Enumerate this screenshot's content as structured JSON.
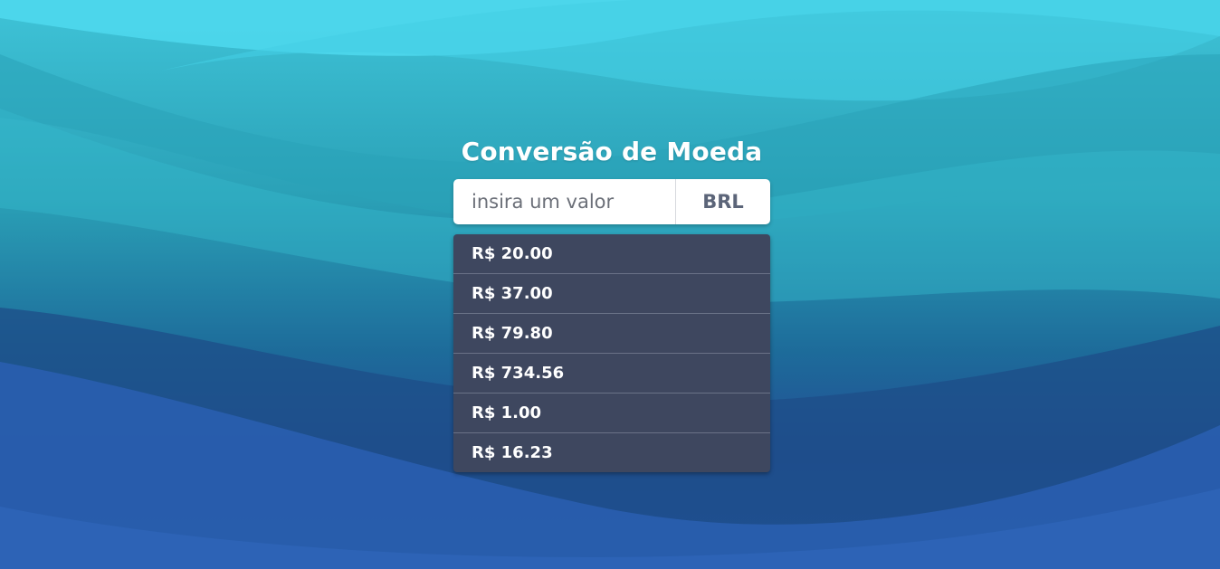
{
  "page": {
    "title": "Conversão de Moeda"
  },
  "converter": {
    "input_value": "",
    "input_placeholder": "insira um valor",
    "currency": "BRL"
  },
  "results": [
    {
      "label": "R$ 20.00"
    },
    {
      "label": "R$ 37.00"
    },
    {
      "label": "R$ 79.80"
    },
    {
      "label": "R$ 734.56"
    },
    {
      "label": "R$ 1.00"
    },
    {
      "label": "R$ 16.23"
    }
  ],
  "theme": {
    "background_top": "#3fc4d8",
    "background_bottom": "#2457a6",
    "panel_color": "#3e475f",
    "addon_text_color": "#5c6579"
  }
}
